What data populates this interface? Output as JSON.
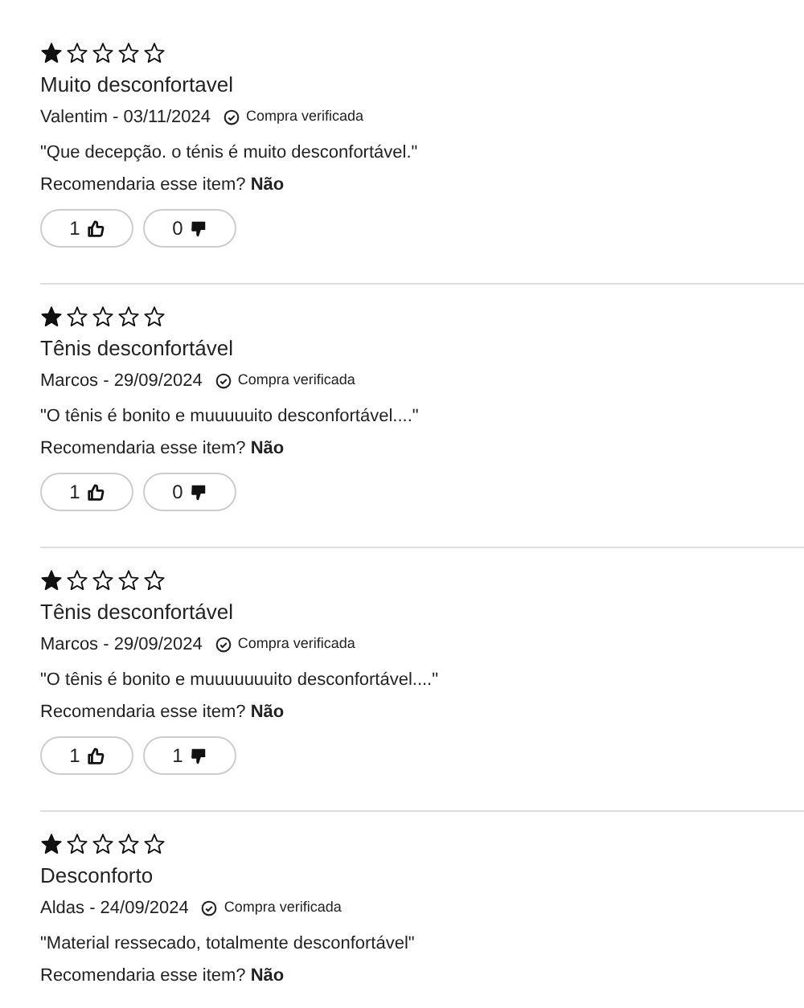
{
  "reviews": [
    {
      "stars": 1,
      "title": "Muito desconfortavel",
      "author_date": "Valentim - 03/11/2024",
      "verified": "Compra verificada",
      "text": "\"Que decepção. o ténis é muito desconfortável.\"",
      "recommend": "Recomendaria esse item? **Não**",
      "likes": "1",
      "dislikes": "0"
    },
    {
      "stars": 1,
      "title": "Tênis desconfortável",
      "author_date": "Marcos - 29/09/2024",
      "verified": "Compra verificada",
      "text": "\"O tênis é bonito e muuuuuito desconfortável....\"",
      "recommend": "Recomendaria esse item? **Não**",
      "likes": "1",
      "dislikes": "0"
    },
    {
      "stars": 1,
      "title": "Tênis desconfortável",
      "author_date": "Marcos - 29/09/2024",
      "verified": "Compra verificada",
      "text": "\"O tênis é bonito e muuuuuuuito desconfortável....\"",
      "recommend": "Recomendaria esse item? **Não**",
      "likes": "1",
      "dislikes": "1"
    },
    {
      "stars": 1,
      "title": "Desconforto",
      "author_date": "Aldas - 24/09/2024",
      "verified": "Compra verificada",
      "text": "\"Material ressecado, totalmente desconfortável\"",
      "recommend": "Recomendaria esse item? **Não**"
    }
  ]
}
